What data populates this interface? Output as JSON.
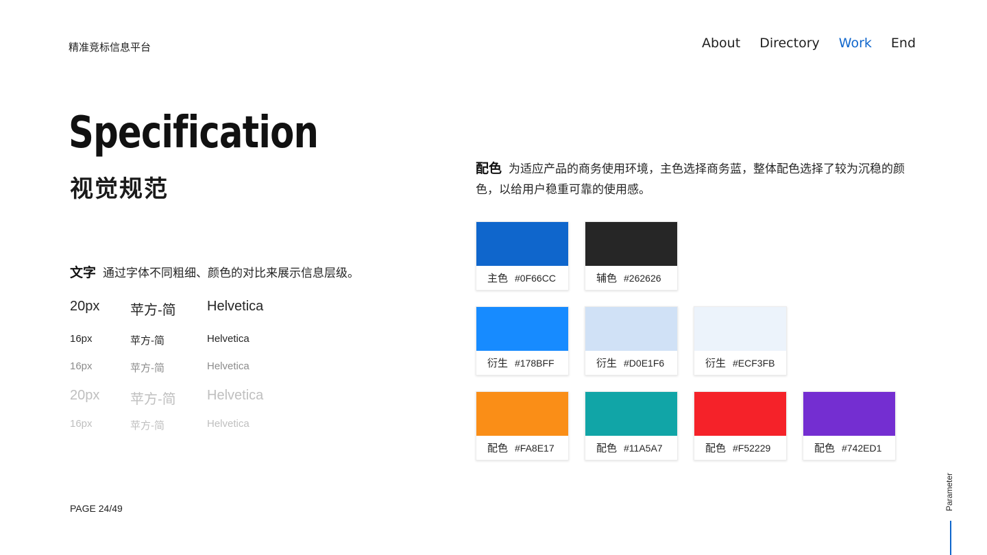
{
  "header": {
    "brand": "精准竞标信息平台",
    "nav": [
      {
        "label": "About",
        "active": false
      },
      {
        "label": "Directory",
        "active": false
      },
      {
        "label": "Work",
        "active": true
      },
      {
        "label": "End",
        "active": false
      }
    ]
  },
  "hero": {
    "title": "Specification",
    "subtitle": "视觉规范"
  },
  "text_section": {
    "label": "文字",
    "desc": "通过字体不同粗细、颜色的对比来展示信息层级。",
    "rows": [
      {
        "size": "20px",
        "font_cn": "苹方-简",
        "font_en": "Helvetica",
        "color": "#262626"
      },
      {
        "size": "16px",
        "font_cn": "苹方-简",
        "font_en": "Helvetica",
        "color": "#262626"
      },
      {
        "size": "16px",
        "font_cn": "苹方-简",
        "font_en": "Helvetica",
        "color": "#8c8c8c"
      },
      {
        "size": "20px",
        "font_cn": "苹方-简",
        "font_en": "Helvetica",
        "color": "#bfbfbf"
      },
      {
        "size": "16px",
        "font_cn": "苹方-简",
        "font_en": "Helvetica",
        "color": "#bfbfbf"
      }
    ]
  },
  "color_section": {
    "label": "配色",
    "desc": "为适应产品的商务使用环境，主色选择商务蓝，整体配色选择了较为沉稳的颜色，以给用户稳重可靠的使用感。",
    "swatches": [
      {
        "name": "主色",
        "hex": "#0F66CC",
        "color": "#0F66CC"
      },
      {
        "name": "辅色",
        "hex": "#262626",
        "color": "#262626"
      },
      {
        "name": "衍生",
        "hex": "#178BFF",
        "color": "#178BFF"
      },
      {
        "name": "衍生",
        "hex": "#D0E1F6",
        "color": "#D0E1F6"
      },
      {
        "name": "衍生",
        "hex": "#ECF3FB",
        "color": "#ECF3FB"
      },
      {
        "name": "配色",
        "hex": "#FA8E17",
        "color": "#FA8E17"
      },
      {
        "name": "配色",
        "hex": "#11A5A7",
        "color": "#11A5A7"
      },
      {
        "name": "配色",
        "hex": "#F52229",
        "color": "#F52229"
      },
      {
        "name": "配色",
        "hex": "#742ED1",
        "color": "#742ED1"
      }
    ]
  },
  "footer": {
    "page": "PAGE 24/49",
    "side_label": "Parameter"
  }
}
